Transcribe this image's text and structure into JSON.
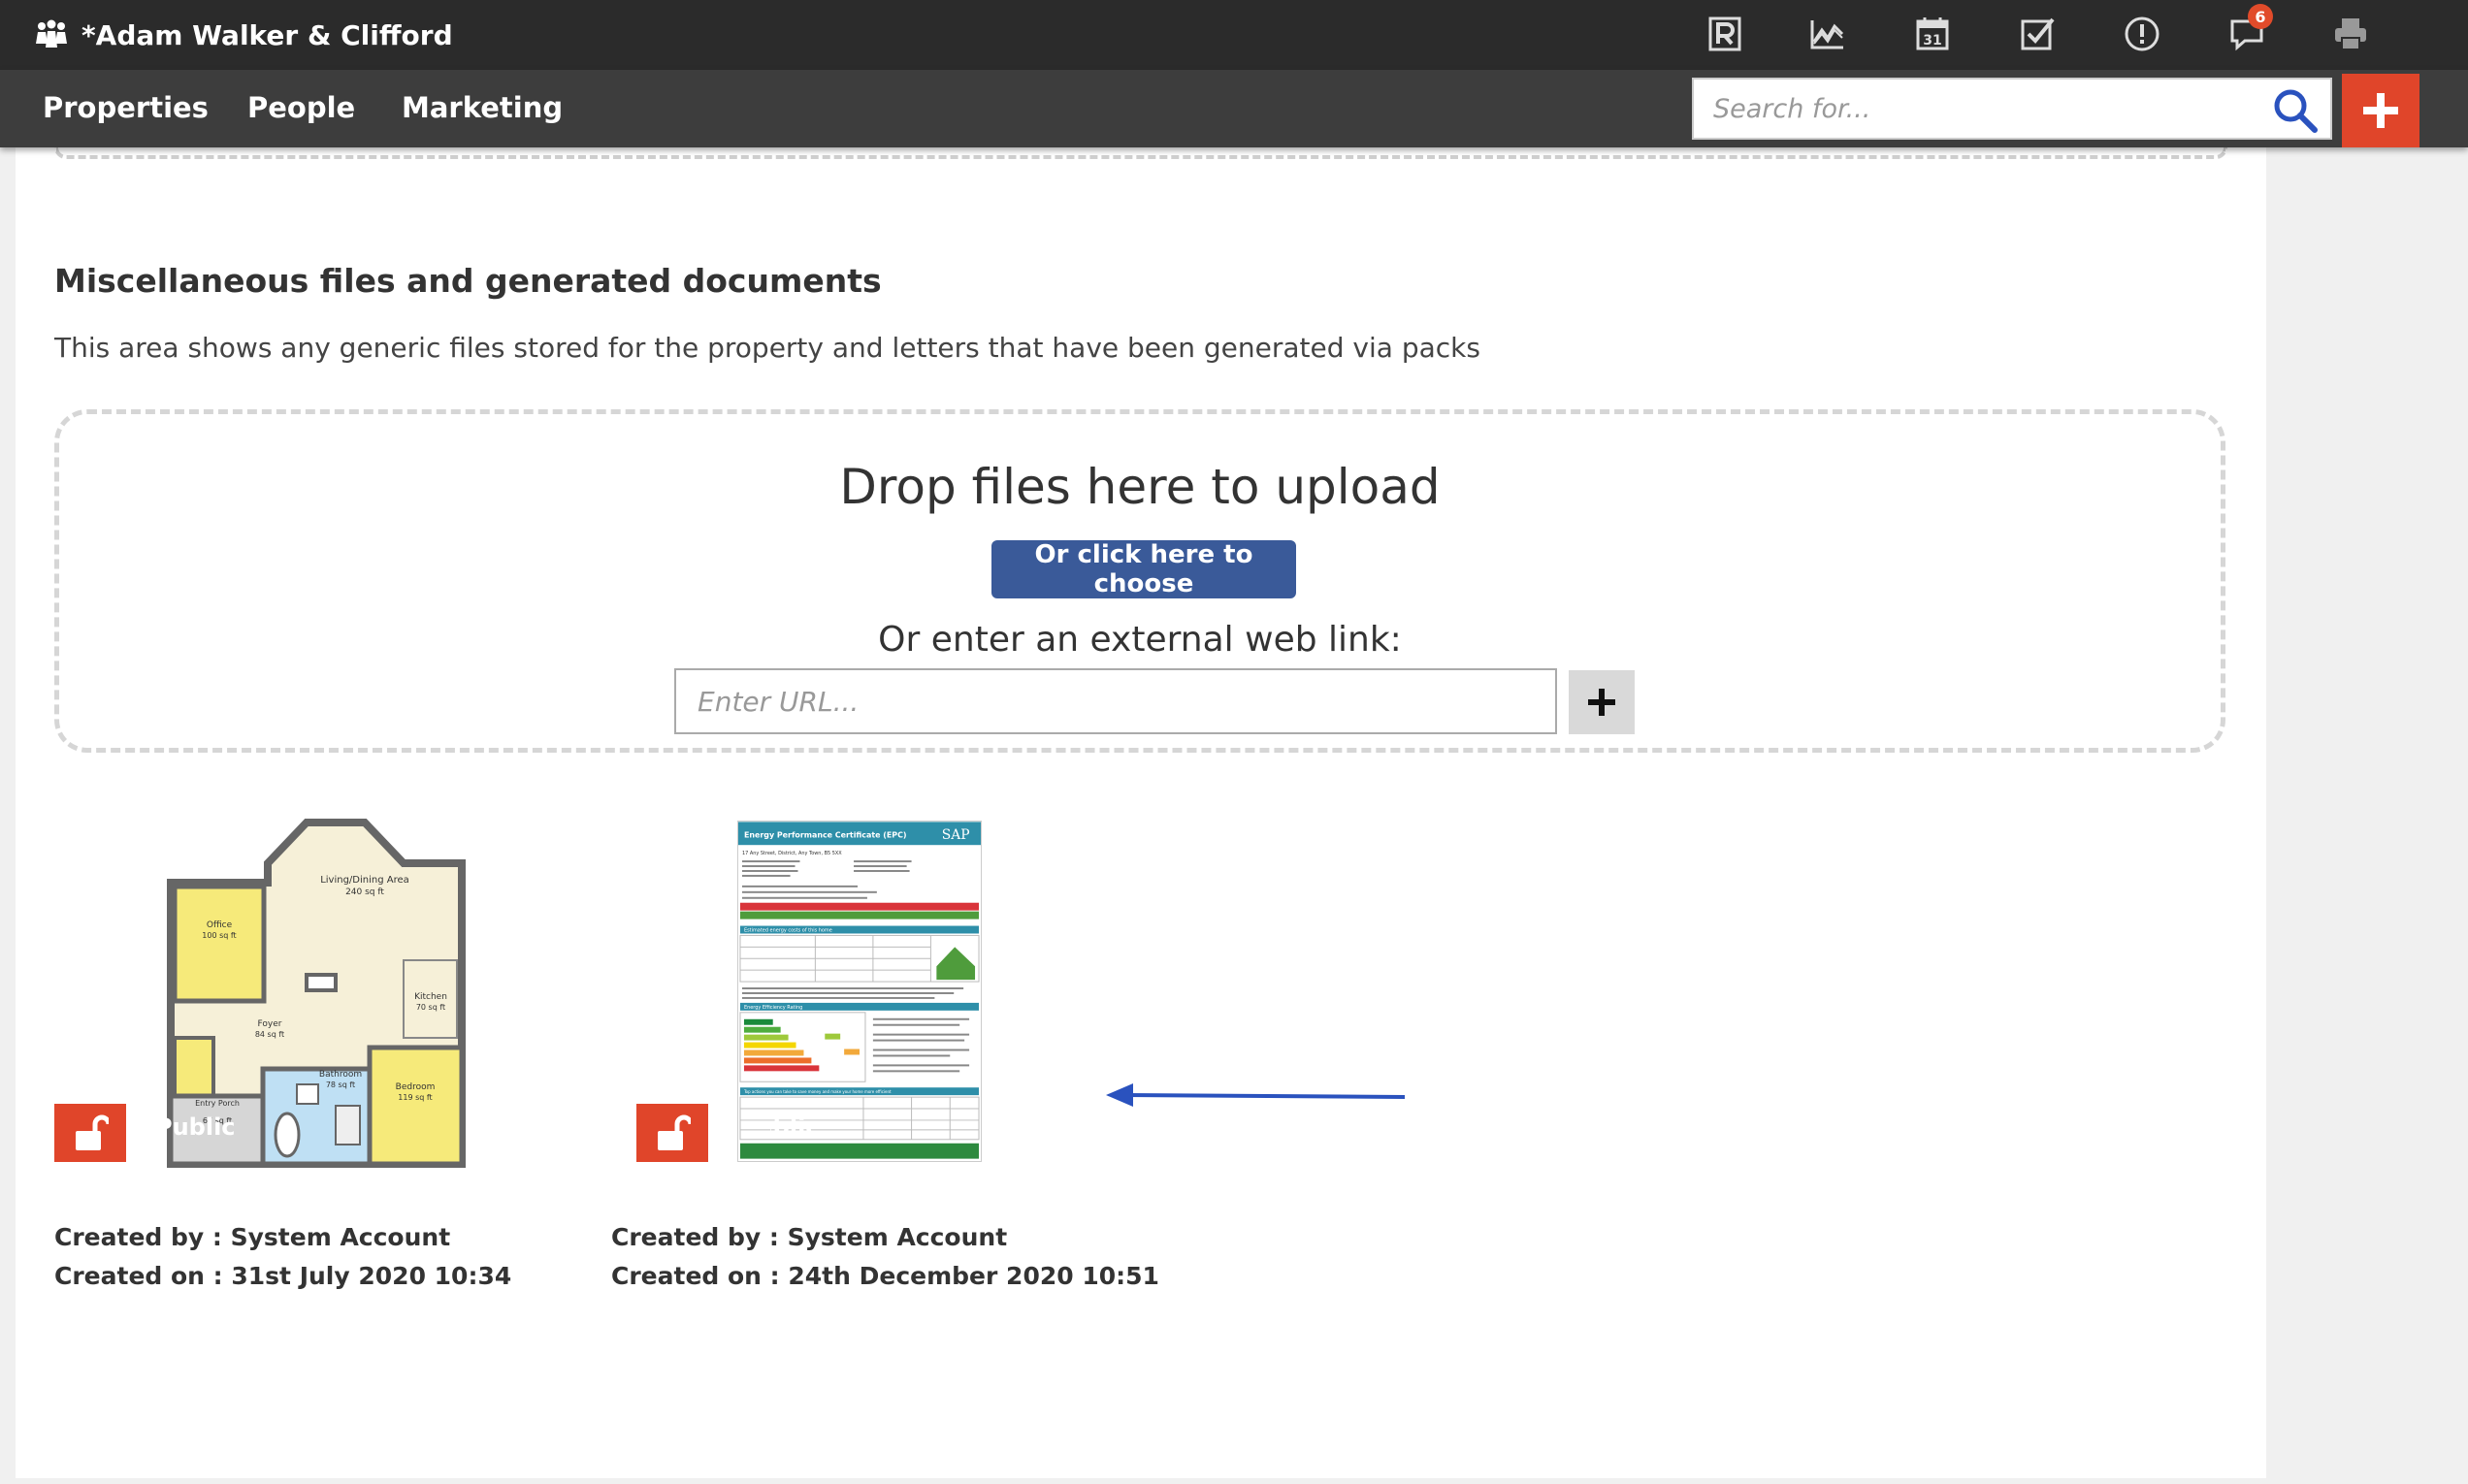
{
  "header": {
    "title": "*Adam Walker & Clifford",
    "notification_count": "6"
  },
  "nav": {
    "items": [
      "Properties",
      "People",
      "Marketing"
    ]
  },
  "search": {
    "placeholder": "Search for..."
  },
  "section": {
    "title": "Miscellaneous files and generated documents",
    "description": "This area shows any generic files stored for the property and letters that have been generated via packs"
  },
  "upload": {
    "drop_text": "Drop files here to upload",
    "choose_label": "Or click here to choose",
    "external_link_label": "Or enter an external web link:",
    "url_placeholder": "Enter URL..."
  },
  "files": [
    {
      "visibility": "Public",
      "created_by": "Created by : System Account",
      "created_on": "Created on : 31st July 2020 10:34"
    },
    {
      "visibility": "Public",
      "created_by": "Created by : System Account",
      "created_on": "Created on : 24th December 2020 10:51"
    }
  ],
  "floorplan": {
    "rooms": [
      "Living/Dining Area",
      "240 sq ft",
      "Office",
      "100 sq ft",
      "Kitchen",
      "70 sq ft",
      "Foyer",
      "84 sq ft",
      "Bathroom",
      "78 sq ft",
      "Entry Porch",
      "67 sq ft",
      "Bedroom",
      "119 sq ft"
    ]
  },
  "epc": {
    "title": "Energy Performance Certificate (EPC)",
    "address": "17 Any Street, District, Any Town, B5 5XX",
    "logo": "SAP",
    "sections": [
      "Estimated energy costs of this home",
      "Energy Efficiency Rating",
      "Top actions you can take to save money and make your home more efficient"
    ]
  },
  "colors": {
    "accent": "#e0452a",
    "primary_button": "#3a5a99",
    "topbar": "#2b2b2b",
    "navbar": "#3d3d3d",
    "arrow": "#2a52be"
  }
}
